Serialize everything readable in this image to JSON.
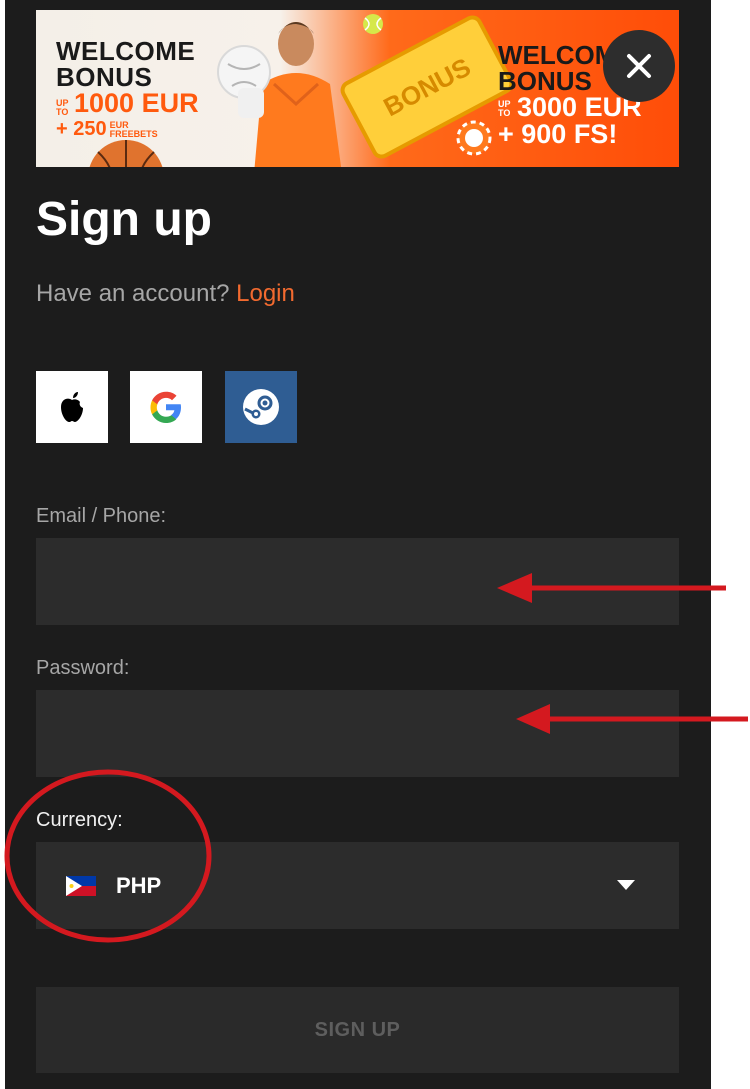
{
  "banner": {
    "left": {
      "line1": "WELCOME",
      "line2": "BONUS",
      "up_to": "UP TO",
      "amount": "1000 EUR",
      "freebets_amount": "+ 250",
      "freebets_unit": "EUR FREEBETS"
    },
    "ticket_text": "BONUS",
    "right": {
      "line1": "WELCOME",
      "line2": "BONUS",
      "up_to": "UP TO",
      "amount": "3000 EUR",
      "fs": "+ 900 FS!"
    }
  },
  "close_icon": "close-icon",
  "page": {
    "title": "Sign up",
    "have_account": "Have an account?",
    "login_link": "Login"
  },
  "social": [
    {
      "name": "apple-icon"
    },
    {
      "name": "google-icon"
    },
    {
      "name": "steam-icon"
    }
  ],
  "form": {
    "email_label": "Email / Phone:",
    "email_value": "",
    "password_label": "Password:",
    "password_value": "",
    "currency_label": "Currency:",
    "currency_value": "PHP",
    "submit_label": "SIGN UP"
  },
  "colors": {
    "panel_bg": "#1c1c1c",
    "field_bg": "#2c2c2c",
    "accent": "#f26a2f",
    "annotation_red": "#d4191f",
    "steam_blue": "#2f5d93"
  }
}
